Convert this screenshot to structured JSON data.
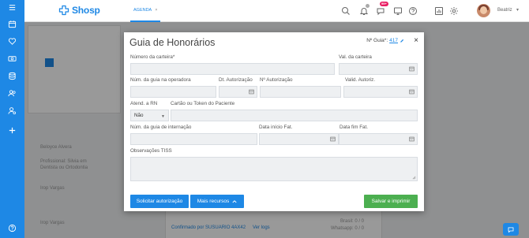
{
  "app": {
    "logo_text": "Shosp",
    "tab_label": "AGENDA",
    "tab_close": "×",
    "notification_badge": "99+",
    "user_name": "Beatriz"
  },
  "background": {
    "texts": [
      "Beloyce Alvera",
      "Profissional: Silvia em",
      "Dentista ou Ortodontia",
      "Irop Vargas",
      "Irop Vargas",
      "Confirmado por SUSUARIO 4AX42",
      "Ver logs",
      "Whatsapp: 0 / 0",
      "Brasil: 0 / 0"
    ]
  },
  "modal": {
    "title": "Guia de Honorários",
    "guia_label": "Nº Guia*:",
    "guia_number": "417",
    "close_symbol": "×",
    "labels": {
      "numero_carteira": "Número da carteira*",
      "val_carteira": "Val. da carteira",
      "num_guia_operadora": "Núm. da guia na operadora",
      "dt_autorizacao": "Dt. Autorização",
      "n_autorizacao": "Nº Autorização",
      "valid_autoriz": "Valid. Autoriz.",
      "atend_rn": "Atend. a RN",
      "cartao_token": "Cartão ou Token do Paciente",
      "num_guia_internacao": "Núm. da guia de internação",
      "data_inicio_fat": "Data início Fat.",
      "data_fim_fat": "Data fim Fat.",
      "observacoes": "Observações TISS"
    },
    "atend_rn_value": "Não",
    "buttons": {
      "solicitar": "Solicitar autorização",
      "mais_recursos": "Mais recursos",
      "salvar": "Salvar e imprimir"
    }
  },
  "colors": {
    "primary": "#1e88e5",
    "success": "#4caf50",
    "badge": "#e91e63"
  }
}
